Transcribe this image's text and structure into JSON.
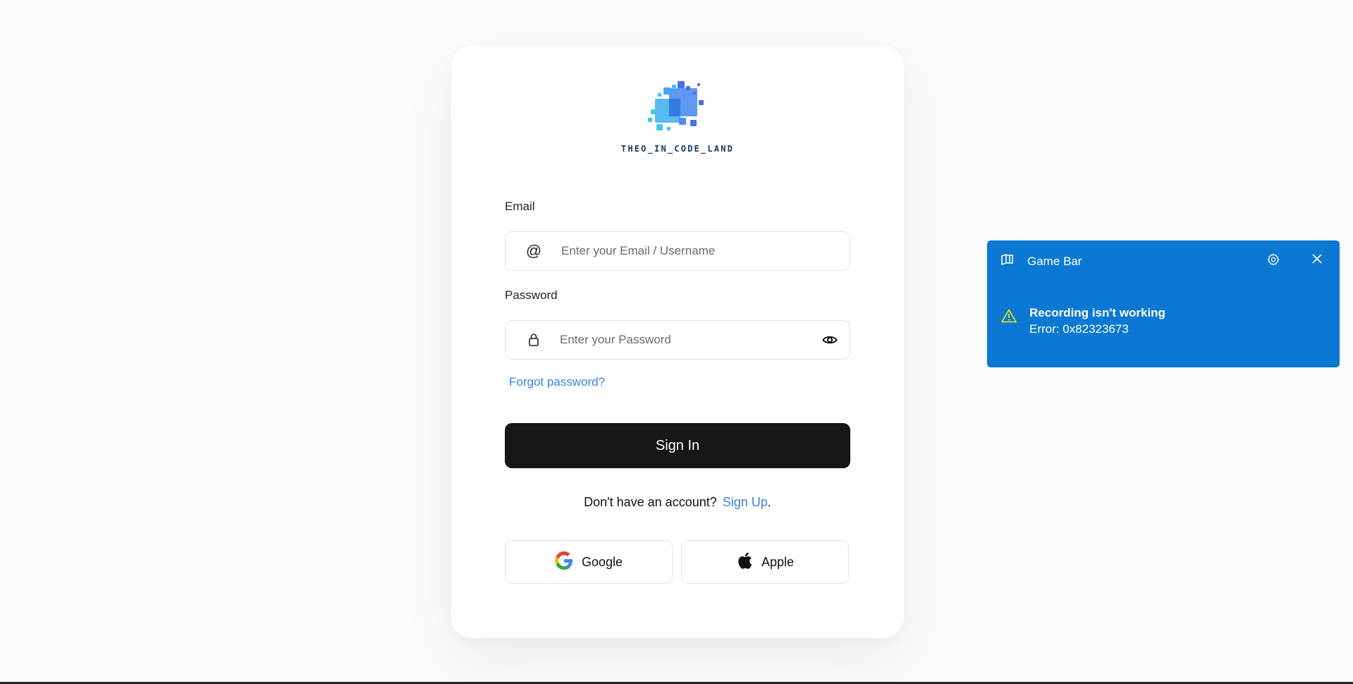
{
  "login": {
    "brand_name": "THEO_IN_CODE_LAND",
    "email_label": "Email",
    "email_placeholder": "Enter your Email / Username",
    "email_icon": "@",
    "password_label": "Password",
    "password_placeholder": "Enter your Password",
    "forgot_password": "Forgot password?",
    "sign_in_label": "Sign In",
    "signup_prompt": "Don't have an account?",
    "signup_link": "Sign Up",
    "signup_suffix": ".",
    "google_label": "Google",
    "apple_label": "Apple"
  },
  "toast": {
    "app_name": "Game Bar",
    "title": "Recording isn't working",
    "body": "Error: 0x82323673"
  },
  "colors": {
    "accent_link": "#3b82d6",
    "button_dark": "#161818",
    "toast_bg": "#0b78d4",
    "brand_text": "#17395c"
  },
  "icons": {
    "email": "at-sign-icon",
    "password": "lock-icon",
    "reveal": "eye-icon",
    "google": "google-logo-icon",
    "apple": "apple-logo-icon",
    "gamebar": "gamebar-icon",
    "settings": "gear-icon",
    "close": "close-icon",
    "warning": "warning-icon"
  }
}
